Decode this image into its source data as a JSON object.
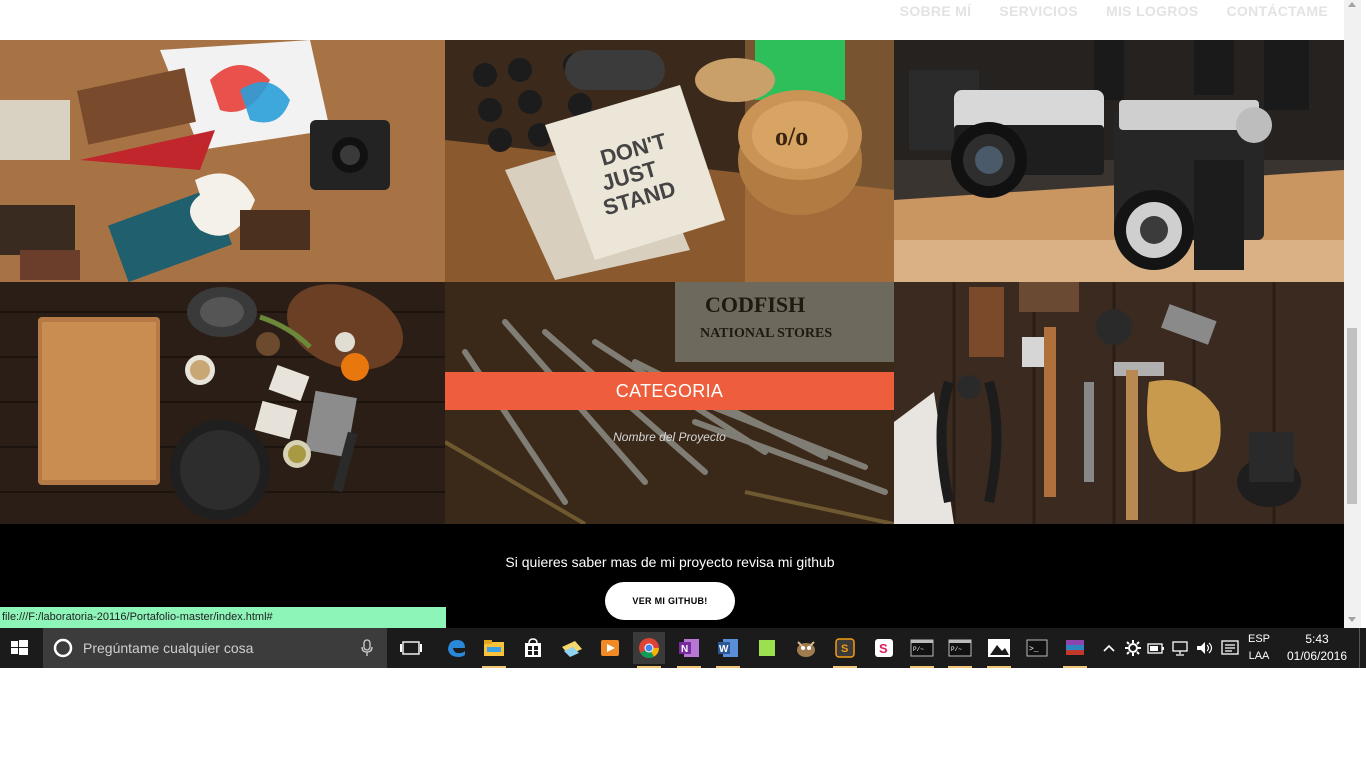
{
  "nav": {
    "items": [
      "SOBRE MÍ",
      "SERVICIOS",
      "MIS LOGROS",
      "CONTÁCTAME"
    ]
  },
  "portfolio": {
    "hover": {
      "category": "CATEGORIA",
      "project": "Nombre del Proyecto"
    }
  },
  "footer": {
    "text": "Si quieres saber mas de mi proyecto revisa mi github",
    "button": "VER MI GITHUB!"
  },
  "status_url": "file:///F:/laboratoria-20116/Portafolio-master/index.html#",
  "taskbar": {
    "search_placeholder": "Pregúntame cualquier cosa",
    "lang_top": "ESP",
    "lang_bottom": "LAA",
    "time": "5:43",
    "date": "01/06/2016"
  },
  "colors": {
    "accent": "#ee5e3c",
    "footer_bg": "#000000",
    "status_bg": "#8ef5b8"
  }
}
